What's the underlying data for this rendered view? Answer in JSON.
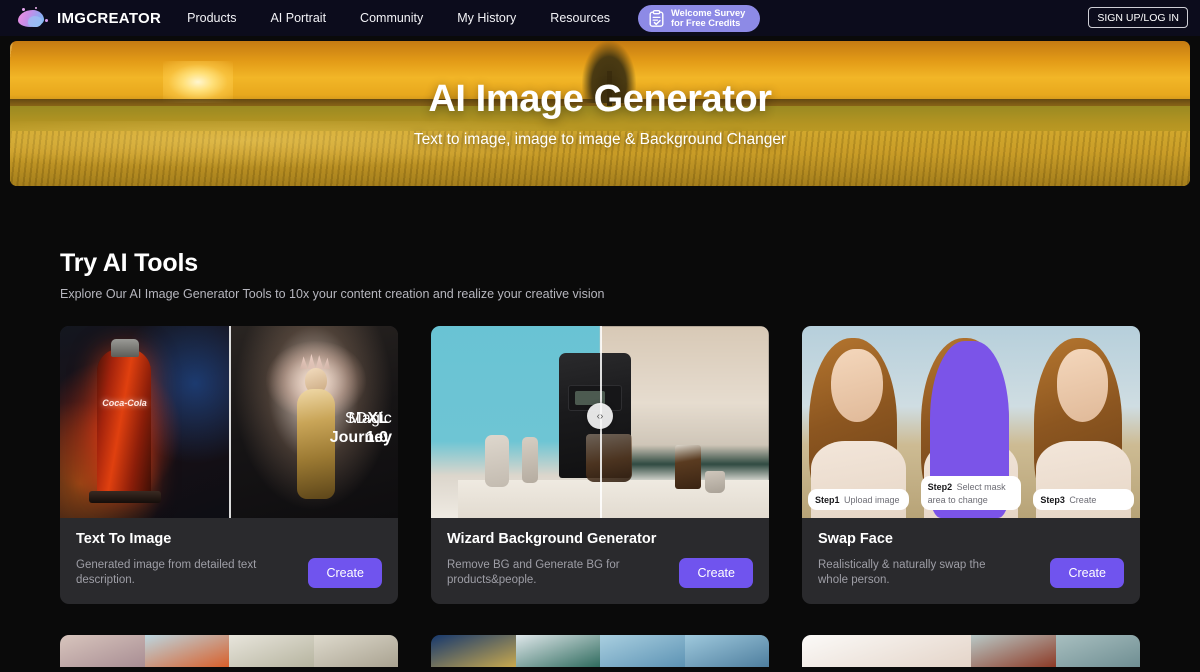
{
  "nav": {
    "brand": "IMGCREATOR",
    "brand_icon": "blob-logo-icon",
    "links": [
      {
        "label": "Products"
      },
      {
        "label": "AI Portrait"
      },
      {
        "label": "Community"
      },
      {
        "label": "My History"
      },
      {
        "label": "Resources"
      }
    ],
    "survey": {
      "icon": "clipboard-check-icon",
      "line1": "Welcome Survey",
      "line2": "for Free Credits",
      "bg_color": "#8d8ae6"
    },
    "signup_label": "SIGN UP/LOG IN",
    "bg_color": "#0c0c1c"
  },
  "hero": {
    "title": "AI Image Generator",
    "subtitle": "Text to image, image to image & Background Changer",
    "image_description": "golden wheat field at sunset with sun rays and a tree"
  },
  "section": {
    "title": "Try AI Tools",
    "subtitle": "Explore Our AI Image Generator Tools to 10x your content creation and realize your creative vision"
  },
  "cards": [
    {
      "title": "Text To Image",
      "description": "Generated image from detailed text description.",
      "button": "Create",
      "media": {
        "left_label_thin": "Magic",
        "left_label_bold": "Journey",
        "left_brand": "Coca-Cola",
        "right_label_thin": "SD",
        "right_label_bold": "XL",
        "right_version": "1.0"
      }
    },
    {
      "title": "Wizard Background Generator",
      "description": "Remove BG and Generate BG for products&people.",
      "button": "Create",
      "media": {
        "slider_icon": "slider-handle-icon"
      }
    },
    {
      "title": "Swap Face",
      "description": "Realistically & naturally swap the whole person.",
      "button": "Create",
      "media": {
        "steps": [
          {
            "num": "Step1",
            "text": "Upload image"
          },
          {
            "num": "Step2",
            "text": "Select mask area to change"
          },
          {
            "num": "Step3",
            "text": "Create"
          }
        ],
        "mask_color": "#7b54e8"
      }
    }
  ],
  "cards_row2": [
    {
      "thumb_colors": [
        "#cbb7b0",
        "#b9d3dd",
        "#d6d3c6",
        "#cfcabc"
      ]
    },
    {
      "thumb_colors": [
        "#1b3a6b",
        "#c9d7dc",
        "#a8cfdd",
        "#7fb6cf"
      ]
    },
    {
      "thumb_colors": [
        "#f3efec",
        "#d9c3b6",
        "#9fb6b4",
        "#8a3a28"
      ]
    }
  ],
  "colors": {
    "page_bg": "#0a0a0a",
    "card_bg": "#2a2a2d",
    "accent_purple": "#7054ee",
    "text_primary": "#ffffff",
    "text_muted": "#9e9ea6"
  }
}
